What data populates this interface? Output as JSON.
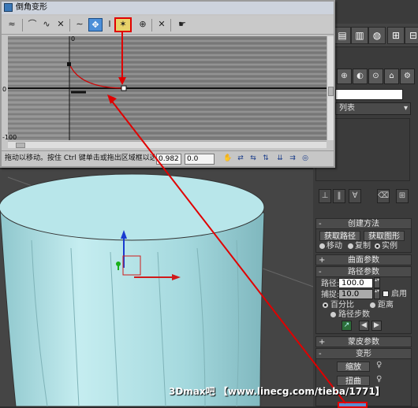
{
  "dialog": {
    "title": "倒角变形",
    "toolbar": [
      "≈",
      "⌒",
      "∿",
      "✕",
      "∼",
      "✥",
      "Ⅰ",
      "✶",
      "⊕",
      "✕",
      "☛"
    ],
    "axis_labels": {
      "top": "0",
      "mid": "0",
      "bottom": "-100"
    },
    "status_text": "拖动以移动。按住 Ctrl 键单击或拖出区域框以选",
    "field_1": "0.982",
    "field_2": "0.0",
    "status_icons": [
      "✋",
      "⇄",
      "⇆",
      "⇅",
      "⇊",
      "⇉",
      "◎"
    ]
  },
  "panel": {
    "tabs": [
      "⊕",
      "◐",
      "⊙",
      "⌂",
      "⚙"
    ],
    "name_field": "",
    "modifier_list": "列表",
    "stack_buttons": [
      "⊥",
      "‖",
      "∀",
      "⌫",
      "⊞"
    ],
    "creation": {
      "title": "创建方法",
      "get_path": "获取路径",
      "get_shape": "获取图形",
      "move": "移动",
      "copy": "复制",
      "instance": "实例"
    },
    "surface": {
      "title": "曲面参数"
    },
    "path": {
      "title": "路径参数",
      "path_label": "路径:",
      "path_value": "100.0",
      "snap_label": "捕捉:",
      "snap_value": "10.0",
      "enable": "启用",
      "percent": "百分比",
      "distance": "距离",
      "steps": "路径步数"
    },
    "skin": {
      "title": "蒙皮参数"
    },
    "deform": {
      "title": "变形",
      "scale": "缩放",
      "twist": "扭曲"
    }
  },
  "watermark": "3Dmax吧 【www.linecg.com/tieba/1771】",
  "colors": {
    "cylinder": "#aee1e6",
    "highlight": "#e00000",
    "graph_bg": "#808080"
  }
}
